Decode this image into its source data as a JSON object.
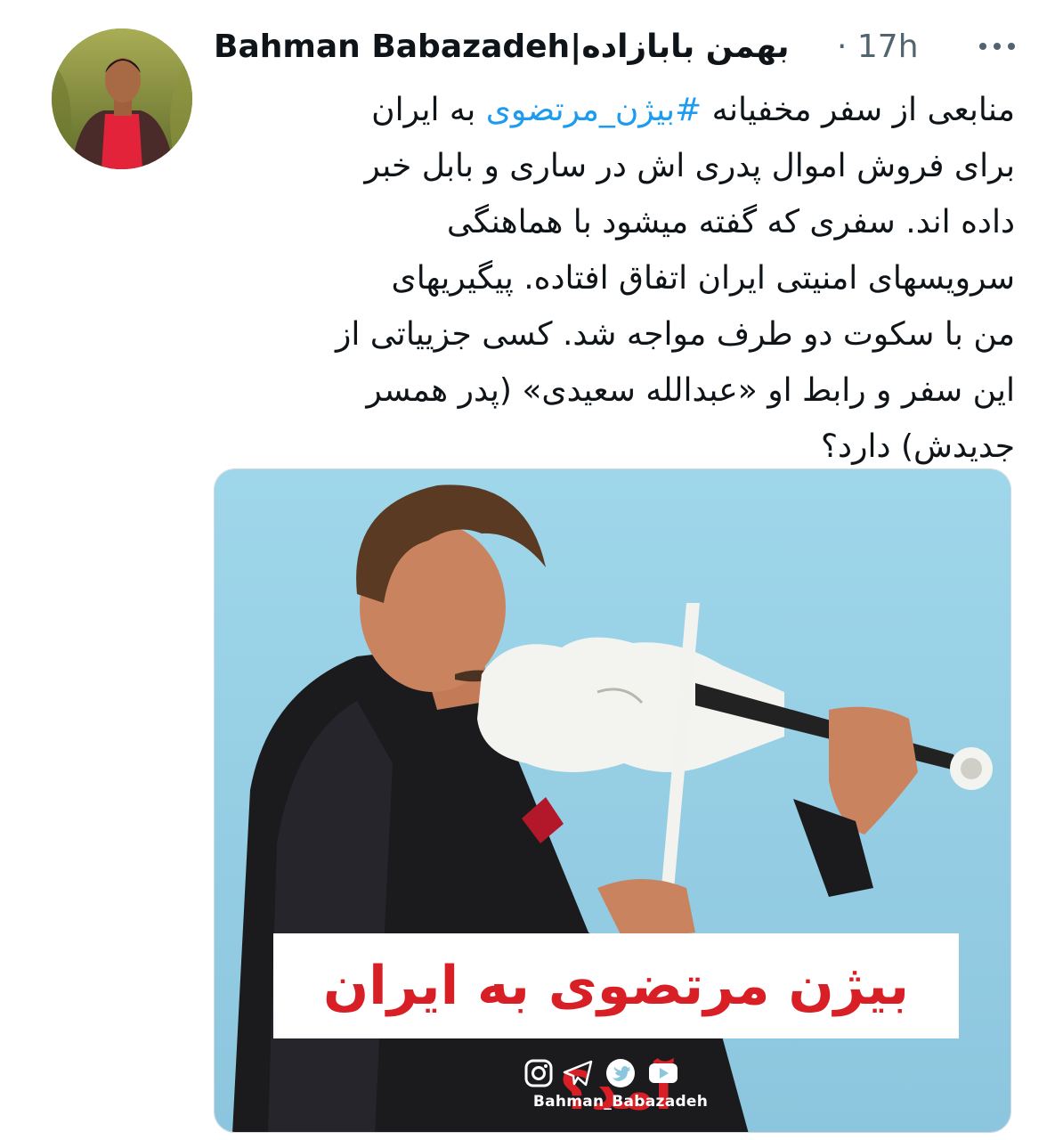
{
  "tweet": {
    "author_name": "Bahman Babazadeh|بهمن بابازاده",
    "separator": "·",
    "time": "17h",
    "more_icon": "more-horizontal-icon",
    "text_lines": [
      {
        "before": "منابعی از سفر مخفیانه ",
        "hashtag": "#بیژن_مرتضوی",
        "after": " به ایران"
      },
      {
        "text": "برای فروش اموال پدری اش در ساری و بابل خبر"
      },
      {
        "text": "داده اند. سفری که گفته میشود با هماهنگی"
      },
      {
        "text": "سرویسهای امنیتی ایران اتفاق افتاده. پیگیریهای"
      },
      {
        "text": "من با سکوت دو طرف مواجه شد. کسی جزییاتی از"
      },
      {
        "text": "این سفر و رابط او «عبدالله سعیدی» (پدر همسر"
      },
      {
        "text": "جدیدش) دارد؟"
      }
    ],
    "link_color": "#1d9bf0"
  },
  "media": {
    "banner_text": "بیژن مرتضوی به ایران آمد؟",
    "banner_color": "#d91f26",
    "social_icons": [
      "instagram-icon",
      "telegram-icon",
      "twitter-icon",
      "youtube-icon"
    ],
    "handle": "Bahman_Babazadeh"
  }
}
